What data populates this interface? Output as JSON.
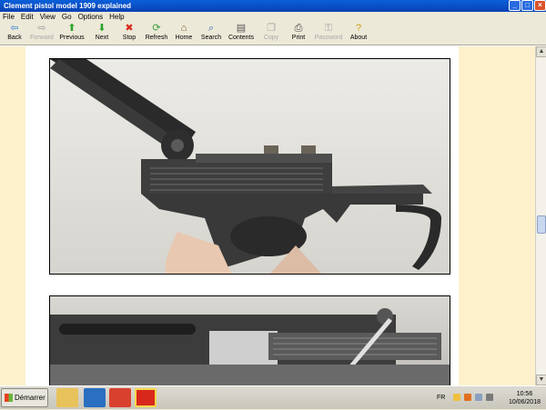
{
  "window": {
    "title": "Clement pistol model 1909 explained"
  },
  "menu": [
    "File",
    "Edit",
    "View",
    "Go",
    "Options",
    "Help"
  ],
  "toolbar": [
    {
      "label": "Back",
      "icon": "back-arrow-icon",
      "glyph": "⇦",
      "color": "#2a7fd6",
      "disabled": false
    },
    {
      "label": "Forward",
      "icon": "forward-arrow-icon",
      "glyph": "⇨",
      "color": "#9a9a9a",
      "disabled": true
    },
    {
      "label": "Previous",
      "icon": "up-arrow-icon",
      "glyph": "⬆",
      "color": "#2aa32a",
      "disabled": false
    },
    {
      "label": "Next",
      "icon": "down-arrow-icon",
      "glyph": "⬇",
      "color": "#2aa32a",
      "disabled": false
    },
    {
      "label": "Stop",
      "icon": "stop-icon",
      "glyph": "✖",
      "color": "#d8281c",
      "disabled": false
    },
    {
      "label": "Refresh",
      "icon": "refresh-icon",
      "glyph": "⟳",
      "color": "#3a9a3a",
      "disabled": false
    },
    {
      "label": "Home",
      "icon": "home-icon",
      "glyph": "⌂",
      "color": "#7a5a1a",
      "disabled": false
    },
    {
      "label": "Search",
      "icon": "search-icon",
      "glyph": "⌕",
      "color": "#3c6aa8",
      "disabled": false
    },
    {
      "label": "Contents",
      "icon": "contents-icon",
      "glyph": "▤",
      "color": "#555555",
      "disabled": false
    },
    {
      "label": "Copy",
      "icon": "copy-icon",
      "glyph": "❐",
      "color": "#a8a8a8",
      "disabled": true
    },
    {
      "label": "Print",
      "icon": "print-icon",
      "glyph": "⎙",
      "color": "#444444",
      "disabled": false
    },
    {
      "label": "Password",
      "icon": "key-icon",
      "glyph": "⚿",
      "color": "#a8a8a8",
      "disabled": true
    },
    {
      "label": "About",
      "icon": "question-icon",
      "glyph": "?",
      "color": "#c89a10",
      "disabled": false
    }
  ],
  "taskbar": {
    "start_label": "Démarrer",
    "apps": [
      {
        "name": "file-explorer-icon",
        "color": "#e8c25a"
      },
      {
        "name": "browser-icon",
        "color": "#2a6fc0"
      },
      {
        "name": "chrome-icon",
        "color": "#d9412f"
      },
      {
        "name": "ebook-reader-icon",
        "color": "#d8281c"
      }
    ],
    "lang": "FR",
    "time": "10:56",
    "date": "10/06/2018"
  }
}
